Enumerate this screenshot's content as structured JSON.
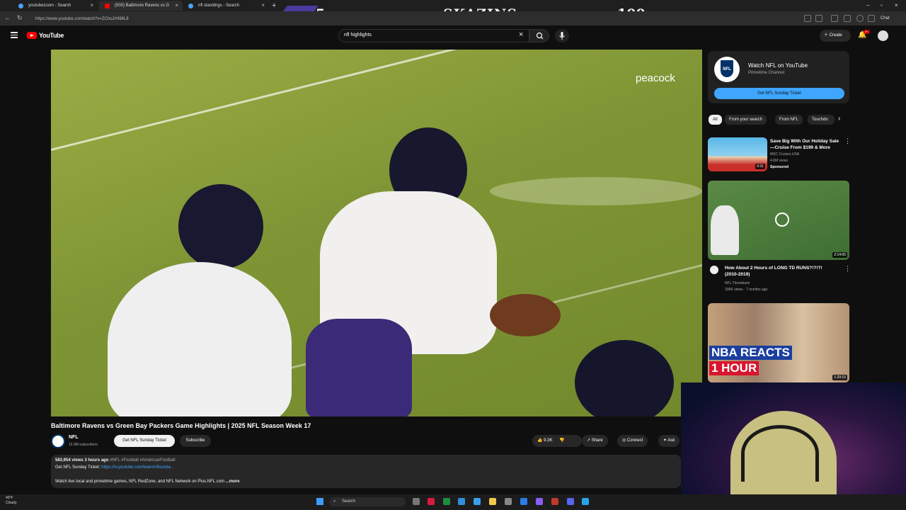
{
  "browser": {
    "tabs": [
      {
        "title": "youtubezoom - Search"
      },
      {
        "title": "(500) Baltimore Ravens vs G"
      },
      {
        "title": "nfl standings - Search"
      }
    ],
    "new_tab_label": "+",
    "url": "https://www.youtube.com/watch?v=ZChuJrhl98L8",
    "chat_label": "Chat"
  },
  "overlay": {
    "left_score": "5",
    "name": "SKAZINS",
    "right_score": "100"
  },
  "youtube": {
    "wordmark": "YouTube",
    "search_query": "nfl highlights",
    "create_label": "Create",
    "notification_count": "9+"
  },
  "video": {
    "watermark": "peacock",
    "title": "Baltimore Ravens vs Green Bay Packers Game Highlights | 2025 NFL Season Week 17",
    "channel_name": "NFL",
    "channel_subs": "15.9M subscribers",
    "sunday_ticket_label": "Get NFL Sunday Ticket",
    "subscribe_label": "Subscribe",
    "likes": "9.3K",
    "share_label": "Share",
    "connect_label": "Connect",
    "ask_label": "Ask",
    "description": {
      "stats": "583,954 views  3 hours ago",
      "tags": "#NFL #Football #AmericanFootball",
      "ticket_prefix": "Get NFL Sunday Ticket:",
      "ticket_link": "https://tv.youtube.com/learn/nflsunda...",
      "watch_line": "Watch live local and primetime games, NFL RedZone, and NFL Network on Plus.NFL.com",
      "more_label": "...more"
    }
  },
  "sidebar": {
    "promo": {
      "title": "Watch NFL on YouTube",
      "subtitle": "Primetime Channel",
      "logo_text": "NFL",
      "button_label": "Get NFL Sunday Ticket"
    },
    "chips": [
      "All",
      "From your search",
      "From NFL",
      "Touchdo"
    ],
    "videos": [
      {
        "title_line1": "Save Big With Our Holiday Sale",
        "title_line2": "—Cruise From $199 & More",
        "channel": "MSC Cruises USA",
        "meta": "4.6M views",
        "badge": "Sponsored",
        "duration": "0:31"
      },
      {
        "title_line1": "How About 2 Hours of LONG TD RUNS?!?!?!",
        "title_line2": "(2010-2019)",
        "channel": "NFL Throwback",
        "meta": "336K views · 7 months ago",
        "duration": "2:14:05"
      },
      {
        "thumb_text1": "NBA REACTS",
        "thumb_text2": "1 HOUR",
        "duration": "1:29:15"
      }
    ]
  },
  "taskbar": {
    "weather_temp": "40°F",
    "weather_desc": "Cloudy",
    "search_label": "Search"
  },
  "icons": [
    "menu-icon",
    "youtube-logo-icon",
    "search-icon",
    "mic-icon",
    "bell-icon",
    "like-icon",
    "dislike-icon",
    "share-icon",
    "more-vert-icon",
    "windows-start-icon"
  ],
  "colors": {
    "background": "#0f0f0f",
    "accent_blue": "#3ea6ff",
    "youtube_red": "#ff0000",
    "overlay_purple": "#4b3a9c"
  }
}
